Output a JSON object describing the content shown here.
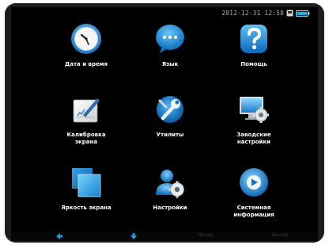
{
  "status": {
    "datetime": "2012-12-31 12:58",
    "usb_icon": "usb-icon",
    "battery_icon": "battery-icon",
    "battery_color": "#19b5e6"
  },
  "menu": {
    "items": [
      {
        "label": "Дата и время",
        "icon": "clock-icon"
      },
      {
        "label": "Язык",
        "icon": "chat-bubble-icon"
      },
      {
        "label": "Помощь",
        "icon": "question-mark-icon"
      },
      {
        "label": "Калибровка\nэкрана",
        "icon": "pen-calibration-icon"
      },
      {
        "label": "Утилиты",
        "icon": "wrench-icon"
      },
      {
        "label": "Заводские\nнастройки",
        "icon": "monitor-gear-icon"
      },
      {
        "label": "Яркость экрана",
        "icon": "brightness-screen-icon"
      },
      {
        "label": "Настройки",
        "icon": "user-settings-icon"
      },
      {
        "label": "Системная\nинформация",
        "icon": "system-info-disc-icon"
      }
    ]
  },
  "bottom": {
    "back_label": "Назад",
    "exit_label": "Выход"
  },
  "colors": {
    "accent": "#1e9be6",
    "background": "#000000"
  }
}
